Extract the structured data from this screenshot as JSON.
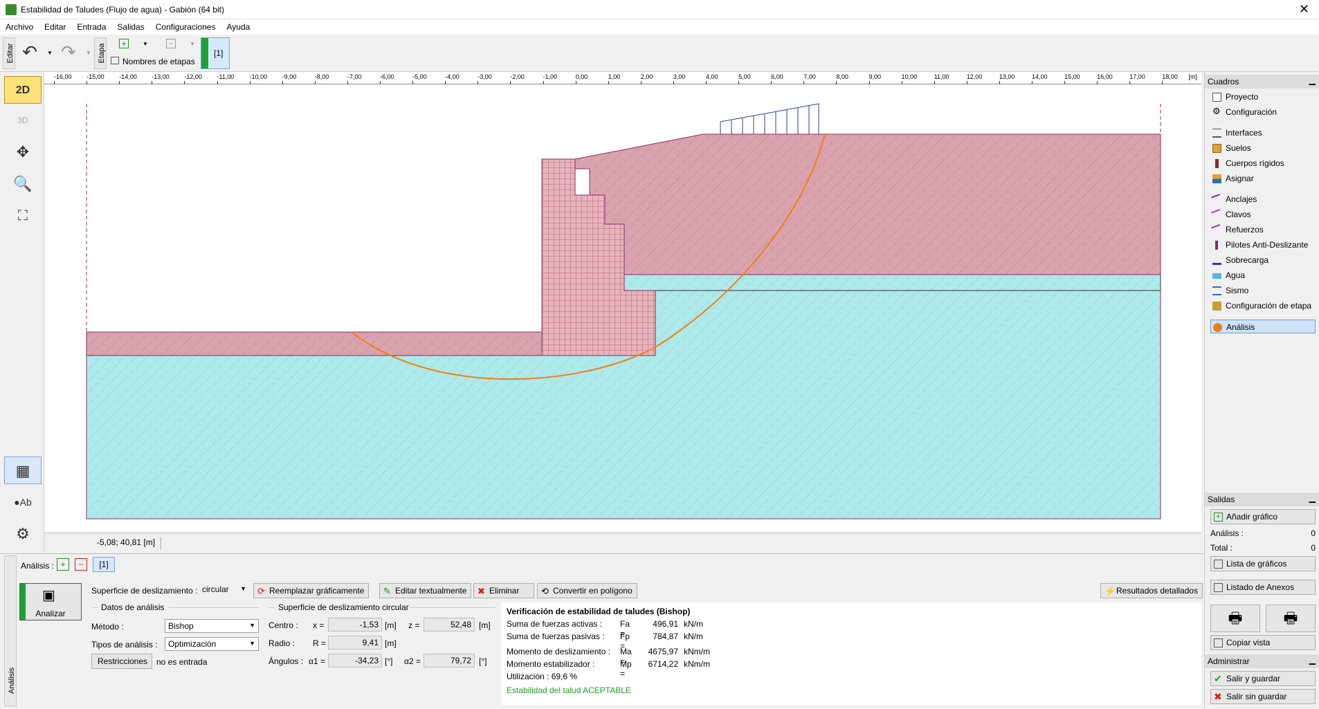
{
  "window": {
    "title": "Estabilidad de Taludes (Flujo de agua) - Gabión (64 bit)"
  },
  "menu": [
    "Archivo",
    "Editar",
    "Entrada",
    "Salidas",
    "Configuraciones",
    "Ayuda"
  ],
  "toolbar": {
    "edit_tab": "Editar",
    "stage_tab": "Etapa",
    "stage_names": "Nombres de etapas",
    "stage_label": "[1]"
  },
  "left_tools": {
    "btn_2d": "2D",
    "btn_3d": "3D"
  },
  "ruler": {
    "ticks": [
      "-16,00",
      "-15,00",
      "-14,00",
      "-13,00",
      "-12,00",
      "-11,00",
      "-10,00",
      "-9,00",
      "-8,00",
      "-7,00",
      "-6,00",
      "-5,00",
      "-4,00",
      "-3,00",
      "-2,00",
      "-1,00",
      "0,00",
      "1,00",
      "2,00",
      "3,00",
      "4,00",
      "5,00",
      "6,00",
      "7,00",
      "8,00",
      "9,00",
      "10,00",
      "11,00",
      "12,00",
      "13,00",
      "14,00",
      "15,00",
      "16,00",
      "17,00",
      "18,00"
    ],
    "unit": "[m]"
  },
  "coords": "-5,08; 40,81 [m]",
  "frames": {
    "title": "Cuadros",
    "items": [
      "Proyecto",
      "Configuración",
      "Interfaces",
      "Suelos",
      "Cuerpos rígidos",
      "Asignar",
      "Anclajes",
      "Clavos",
      "Refuerzos",
      "Pilotes Anti-Deslizante",
      "Sobrecarga",
      "Agua",
      "Sismo",
      "Configuración de etapa",
      "Análisis"
    ]
  },
  "outputs": {
    "title": "Salidas",
    "add_graph": "Añadir gráfico",
    "analysis_label": "Análisis :",
    "analysis_val": "0",
    "total_label": "Total :",
    "total_val": "0",
    "graph_list": "Lista de gráficos",
    "annex_list": "Listado de Anexos",
    "copy_view": "Copiar vista"
  },
  "admin": {
    "title": "Administrar",
    "save_exit": "Salir y guardar",
    "exit_nosave": "Salir sin guardar"
  },
  "analysis": {
    "vtab": "Análisis",
    "header_label": "Análisis :",
    "stage": "[1]",
    "analyze_btn": "Analizar",
    "slip_surface_label": "Superficie de deslizamiento :",
    "slip_surface_val": "circular",
    "replace_graph": "Reemplazar gráficamente",
    "edit_text": "Editar textualmente",
    "delete": "Eliminar",
    "to_polygon": "Convertir en polígono",
    "detailed": "Resultados detallados",
    "data_group": "Datos de análisis",
    "method_label": "Método :",
    "method_val": "Bishop",
    "type_label": "Tipos de análisis :",
    "type_val": "Optimización",
    "restrictions_btn": "Restricciones",
    "restrictions_val": "no es entrada",
    "circle_group": "Superficie de deslizamiento circular",
    "centre_label": "Centro :",
    "x_label": "x =",
    "x_val": "-1,53",
    "x_unit": "[m]",
    "z_label": "z =",
    "z_val": "52,48",
    "z_unit": "[m]",
    "radius_label": "Radio :",
    "r_label": "R =",
    "r_val": "9,41",
    "r_unit": "[m]",
    "angles_label": "Ángulos :",
    "a1_label": "α1 =",
    "a1_val": "-34,23",
    "a1_unit": "[°]",
    "a2_label": "α2 =",
    "a2_val": "79,72",
    "a2_unit": "[°]"
  },
  "results": {
    "title": "Verificación de estabilidad de taludes (Bishop)",
    "rows": [
      {
        "label": "Suma de fuerzas activas :",
        "sym": "Fa =",
        "val": "496,91",
        "unit": "kN/m"
      },
      {
        "label": "Suma de fuerzas pasivas :",
        "sym": "Fp =",
        "val": "784,87",
        "unit": "kN/m"
      },
      {
        "label": "Momento de deslizamiento :",
        "sym": "Ma =",
        "val": "4675,97",
        "unit": "kNm/m"
      },
      {
        "label": "Momento estabilizador :",
        "sym": "Mp =",
        "val": "6714,22",
        "unit": "kNm/m"
      }
    ],
    "utilization": "Utilización : 69,6  %",
    "verdict": "Estabilidad del talud ACEPTABLE"
  },
  "colors": {
    "soil_red": "#d9a3ad",
    "soil_blue": "#aeeaea",
    "gabion": "#e8b3bc",
    "slip": "#f07d14",
    "verdict": "#1f9a2a"
  }
}
